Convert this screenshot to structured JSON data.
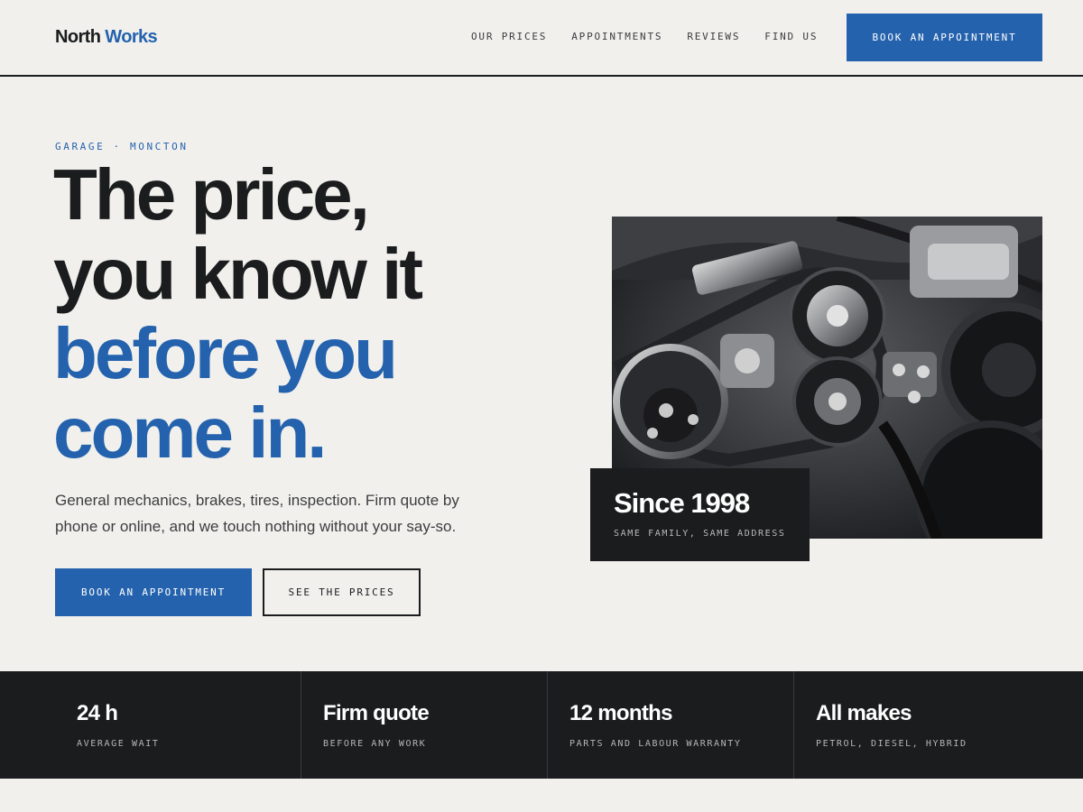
{
  "brand": {
    "name_part1": "North",
    "name_part2": "Works",
    "accent_color": "#2462ad",
    "dark_color": "#1b1c1e",
    "background_color": "#f1f0ed"
  },
  "nav": {
    "items": [
      {
        "label": "OUR PRICES"
      },
      {
        "label": "APPOINTMENTS"
      },
      {
        "label": "REVIEWS"
      },
      {
        "label": "FIND US"
      }
    ],
    "cta_label": "BOOK AN APPOINTMENT"
  },
  "hero": {
    "eyebrow": "GARAGE · MONCTON",
    "headline_lines": [
      "The price,",
      "you know it"
    ],
    "headline_accent_lines": [
      "before you",
      "come in."
    ],
    "lede": "General mechanics, brakes, tires, inspection. Firm quote by phone or online, and we touch nothing without your say-so.",
    "primary_button": "BOOK AN APPOINTMENT",
    "secondary_button": "SEE THE PRICES"
  },
  "photo": {
    "subject": "engine-photo"
  },
  "since_badge": {
    "title": "Since 1998",
    "subtitle": "SAME FAMILY, SAME ADDRESS"
  },
  "stats": [
    {
      "value": "24 h",
      "label": "AVERAGE WAIT"
    },
    {
      "value": "Firm quote",
      "label": "BEFORE ANY WORK"
    },
    {
      "value": "12 months",
      "label": "PARTS AND LABOUR WARRANTY"
    },
    {
      "value": "All makes",
      "label": "PETROL, DIESEL, HYBRID"
    }
  ]
}
